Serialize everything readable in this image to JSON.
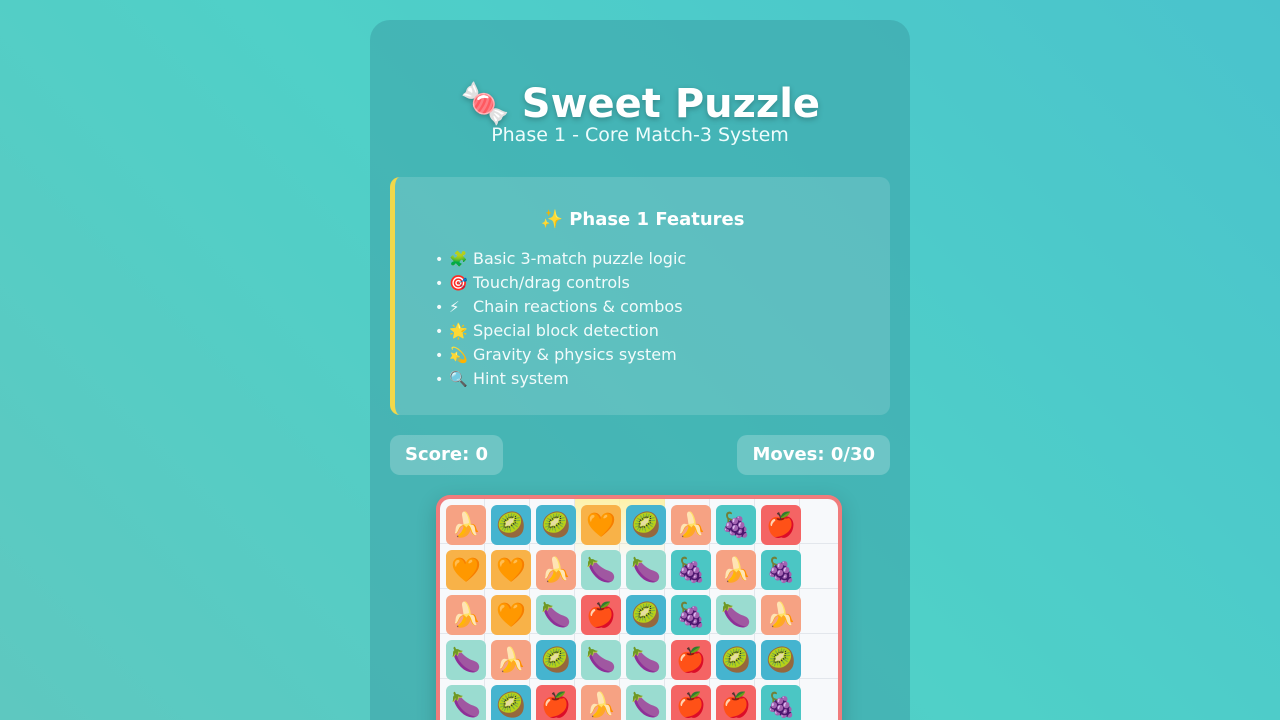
{
  "header": {
    "title_icon": "🍬",
    "title": "Sweet Puzzle",
    "subtitle": "Phase 1 - Core Match-3 System"
  },
  "features": {
    "title": "✨ Phase 1 Features",
    "accent_color": "#f2d84a",
    "items": [
      {
        "icon": "🧩",
        "icon_name": "puzzle-piece-icon",
        "label": "Basic 3-match puzzle logic"
      },
      {
        "icon": "🎯",
        "icon_name": "target-icon",
        "label": "Touch/drag controls"
      },
      {
        "icon": "⚡",
        "icon_name": "lightning-icon",
        "label": "Chain reactions & combos"
      },
      {
        "icon": "🌟",
        "icon_name": "star-icon",
        "label": "Special block detection"
      },
      {
        "icon": "💫",
        "icon_name": "dizzy-star-icon",
        "label": "Gravity & physics system"
      },
      {
        "icon": "🔍",
        "icon_name": "magnifier-icon",
        "label": "Hint system"
      }
    ]
  },
  "stats": {
    "score_label": "Score: 0",
    "moves_label": "Moves: 0/30"
  },
  "board": {
    "border_color": "#f07c7c",
    "hint_columns": [
      3,
      4
    ],
    "tile_types": {
      "banana": {
        "glyph": "🍌",
        "color": "#f6a283"
      },
      "kiwi": {
        "glyph": "🥝",
        "color": "#45b4cf"
      },
      "heart": {
        "glyph": "🧡",
        "color": "#f8b248"
      },
      "grapes": {
        "glyph": "🍇",
        "color": "#4bc6c4"
      },
      "apple": {
        "glyph": "🍎",
        "color": "#f46464"
      },
      "eggplant": {
        "glyph": "🍆",
        "color": "#9adcd0"
      }
    },
    "rows": [
      [
        "banana",
        "kiwi",
        "kiwi",
        "heart",
        "kiwi",
        "banana",
        "grapes",
        "apple"
      ],
      [
        "heart",
        "heart",
        "banana",
        "eggplant",
        "eggplant",
        "grapes",
        "banana",
        "grapes"
      ],
      [
        "banana",
        "heart",
        "eggplant",
        "apple",
        "kiwi",
        "grapes",
        "eggplant",
        "banana"
      ],
      [
        "eggplant",
        "banana",
        "kiwi",
        "eggplant",
        "eggplant",
        "apple",
        "kiwi",
        "kiwi"
      ],
      [
        "eggplant",
        "kiwi",
        "apple",
        "banana",
        "eggplant",
        "apple",
        "apple",
        "grapes"
      ]
    ]
  }
}
